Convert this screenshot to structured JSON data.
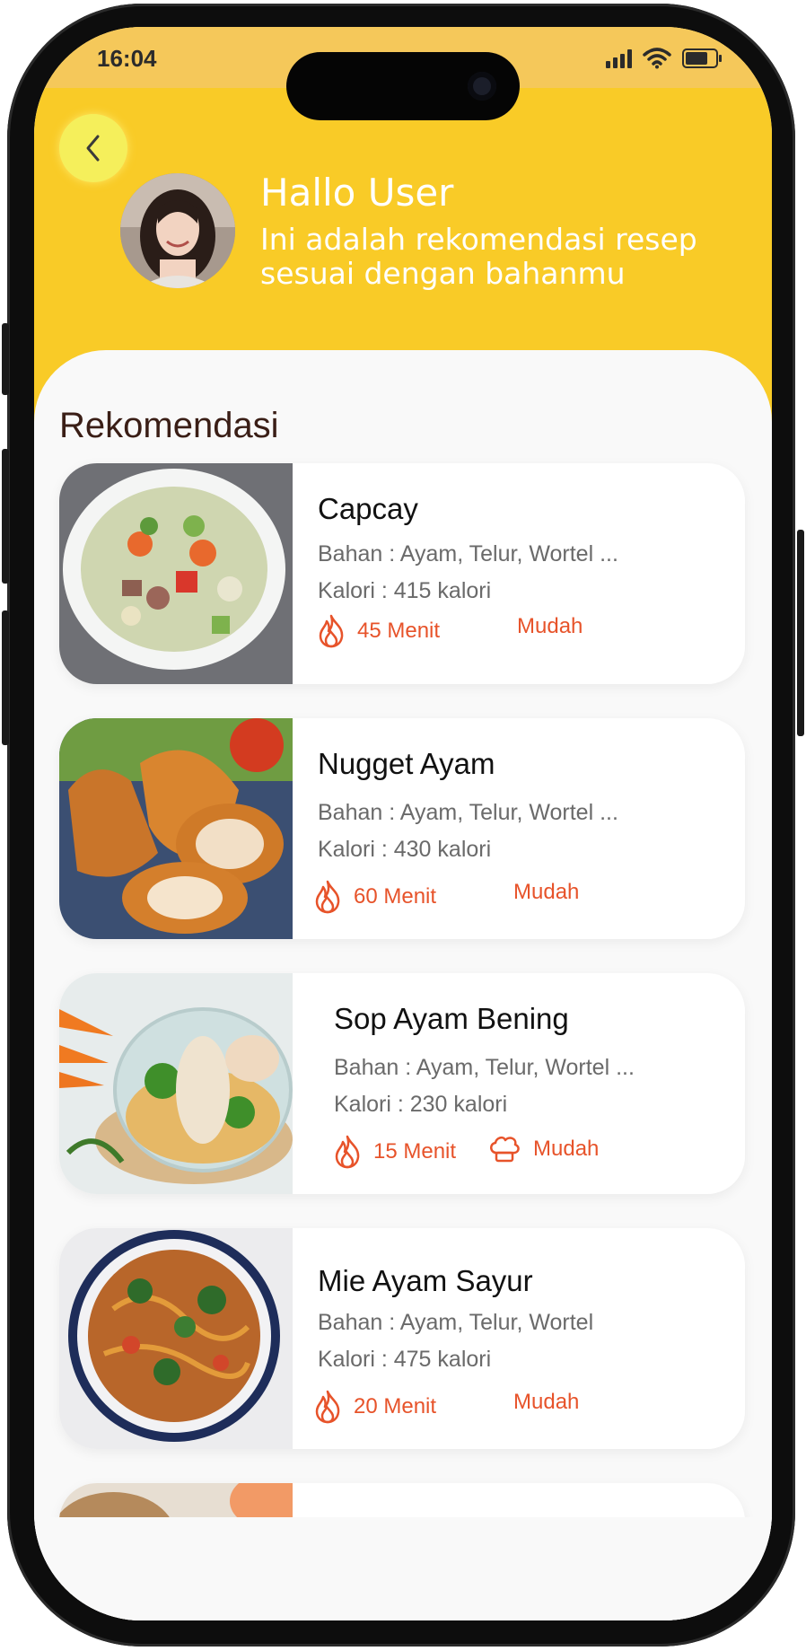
{
  "status_bar": {
    "time": "16:04"
  },
  "header": {
    "greeting": "Hallo User",
    "subtitle": "Ini adalah  rekomendasi resep sesuai dengan bahanmu",
    "accent_color": "#f9cb27",
    "back_icon": "chevron-left-icon"
  },
  "main": {
    "section_title": "Rekomendasi",
    "recipes": [
      {
        "title": "Capcay",
        "ingredients": "Bahan : Ayam, Telur, Wortel ...",
        "calories": "Kalori  : 415 kalori",
        "time": "45 Menit",
        "difficulty": "Mudah"
      },
      {
        "title": "Nugget Ayam",
        "ingredients": "Bahan : Ayam, Telur, Wortel ...",
        "calories": "Kalori  : 430 kalori",
        "time": "60 Menit",
        "difficulty": "Mudah"
      },
      {
        "title": "Sop Ayam Bening",
        "ingredients": "Bahan : Ayam, Telur, Wortel ...",
        "calories": "Kalori  : 230 kalori",
        "time": "15 Menit",
        "difficulty": "Mudah"
      },
      {
        "title": "Mie Ayam Sayur",
        "ingredients": "Bahan : Ayam, Telur, Wortel",
        "calories": "Kalori  : 475 kalori",
        "time": "20 Menit",
        "difficulty": "Mudah"
      }
    ],
    "meta_color": "#e7532a",
    "time_icon": "flame-icon",
    "difficulty_icon": "chef-hat-icon"
  }
}
